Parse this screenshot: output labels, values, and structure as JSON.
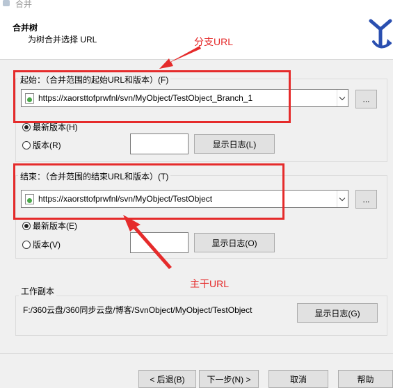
{
  "window": {
    "title": "合并"
  },
  "header": {
    "title": "合并树",
    "subtitle": "为树合并选择 URL"
  },
  "start": {
    "legend": "起始：（合并范围的起始URL和版本）(F)",
    "url": "https://xaorsttofprwfnl/svn/MyObject/TestObject_Branch_1",
    "browse_label": "...",
    "radio_head": "最新版本(H)",
    "radio_rev": "版本(R)",
    "revision_value": "",
    "show_log": "显示日志(L)"
  },
  "end": {
    "legend": "结束：（合并范围的结束URL和版本）(T)",
    "url": "https://xaorsttofprwfnl/svn/MyObject/TestObject",
    "browse_label": "...",
    "radio_head": "最新版本(E)",
    "radio_rev": "版本(V)",
    "revision_value": "",
    "show_log": "显示日志(O)"
  },
  "working_copy": {
    "legend": "工作副本",
    "path": "F:/360云盘/360同步云盘/博客/SvnObject/MyObject/TestObject",
    "show_log": "显示日志(G)"
  },
  "footer": {
    "back": "< 后退(B)",
    "next": "下一步(N) >",
    "cancel": "取消",
    "help": "帮助"
  },
  "annotations": {
    "branch": "分支URL",
    "trunk": "主干URL"
  },
  "colors": {
    "annotation_red": "#e52b2b",
    "logo_blue": "#2a4fb0"
  }
}
